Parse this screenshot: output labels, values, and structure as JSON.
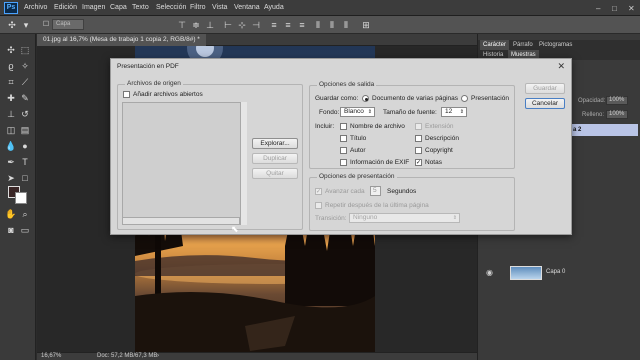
{
  "app": {
    "logo": "Ps",
    "accent": "#4aa3ff"
  },
  "menu": [
    "Archivo",
    "Edición",
    "Imagen",
    "Capa",
    "Texto",
    "Selección",
    "Filtro",
    "Vista",
    "Ventana",
    "Ayuda"
  ],
  "window_controls": {
    "minimize": "–",
    "maximize": "□",
    "close": "✕"
  },
  "options_bar": {
    "layer_select": "Capa"
  },
  "document": {
    "tab_title": "01.jpg al 16,7% (Mesa de trabajo 1 copia 2, RGB/8#) *",
    "zoom": "16,67%",
    "doc_info": "Doc: 57,2 MB/67,3 MB"
  },
  "panels": {
    "top_tabs": [
      "Carácter",
      "Párrafo",
      "Pictogramas"
    ],
    "second_tabs": [
      "Historia",
      "Muestras"
    ],
    "opacity_label": "Opacidad:",
    "opacity_value": "100%",
    "fill_label": "Relleno:",
    "fill_value": "100%",
    "selected_layer": "a 2",
    "layer_label": "Capa 0"
  },
  "dialog": {
    "title": "Presentación en PDF",
    "source_group": "Archivos de origen",
    "add_open_files": "Añadir archivos abiertos",
    "browse": "Explorar...",
    "duplicate": "Duplicar",
    "remove": "Quitar",
    "save": "Guardar",
    "cancel": "Cancelar",
    "output_group": "Opciones de salida",
    "save_as_label": "Guardar como:",
    "multi_page": "Documento de varias páginas",
    "presentation": "Presentación",
    "background_label": "Fondo:",
    "background_value": "Blanco",
    "font_size_label": "Tamaño de fuente:",
    "font_size_value": "12",
    "include_label": "Incluir:",
    "include_options": {
      "filename": "Nombre de archivo",
      "title": "Título",
      "author": "Autor",
      "exif": "Información de EXIF",
      "extension": "Extensión",
      "description": "Descripción",
      "copyright": "Copyright",
      "notes": "Notas"
    },
    "presentation_group": "Opciones de presentación",
    "advance_every": "Avanzar cada",
    "advance_seconds": "5",
    "seconds_label": "Segundos",
    "loop_after_last": "Repetir después de la última página",
    "transition_label": "Transición:",
    "transition_value": "Ninguno"
  }
}
